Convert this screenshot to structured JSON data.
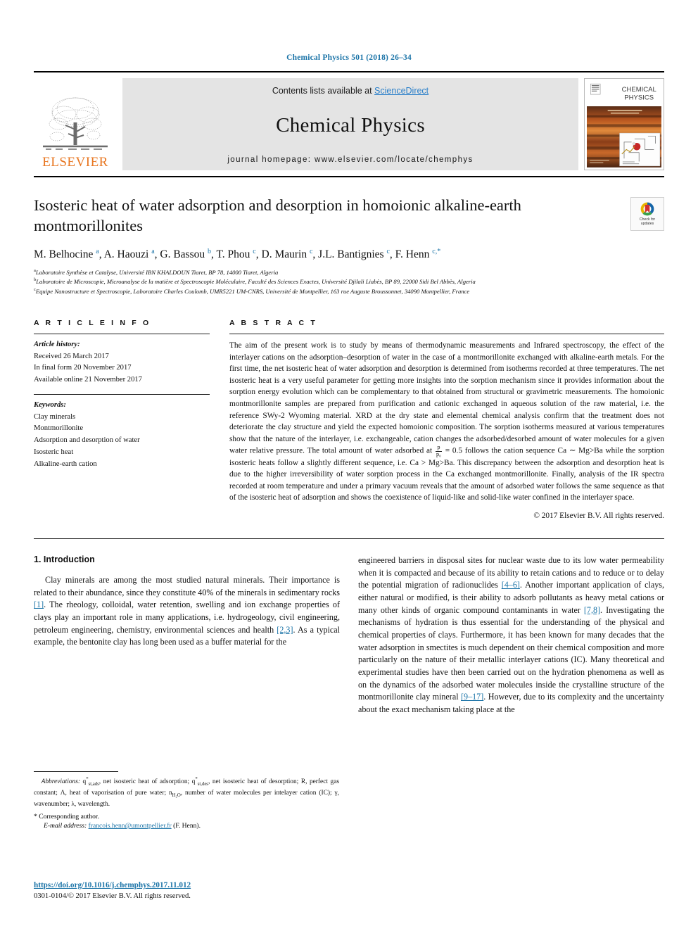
{
  "running_head": "Chemical Physics 501 (2018) 26–34",
  "banner": {
    "publisher": "ELSEVIER",
    "contents_prefix": "Contents lists available at ",
    "contents_link": "ScienceDirect",
    "journal_title": "Chemical Physics",
    "homepage": "journal homepage: www.elsevier.com/locate/chemphys",
    "cover_title_line1": "CHEMICAL",
    "cover_title_line2": "PHYSICS"
  },
  "article": {
    "title": "Isosteric heat of water adsorption and desorption in homoionic alkaline-earth montmorillonites",
    "crossmark_line1": "Check for",
    "crossmark_line2": "updates",
    "authors_html": "M. Belhocine <sup>a</sup>, A. Haouzi <sup>a</sup>, G. Bassou <sup>b</sup>, T. Phou <sup>c</sup>, D. Maurin <sup>c</sup>, J.L. Bantignies <sup>c</sup>, F. Henn <sup>c,*</sup>",
    "affiliations": [
      {
        "marker": "a",
        "text": "Laboratoire Synthèse et Catalyse, Université IBN KHALDOUN Tiaret, BP 78, 14000 Tiaret, Algeria"
      },
      {
        "marker": "b",
        "text": "Laboratoire de Microscopie, Microanalyse de la matière et Spectroscopie Moléculaire, Faculté des Sciences Exactes, Université Djilali Liabès, BP 89, 22000 Sidi Bel Abbès, Algeria"
      },
      {
        "marker": "c",
        "text": "Equipe Nanostructure et Spectroscopie, Laboratoire Charles Coulomb, UMR5221 UM-CNRS, Université de Montpellier, 163 rue Auguste Broussonnet, 34090 Montpellier, France"
      }
    ]
  },
  "article_info": {
    "heading": "A R T I C L E   I N F O",
    "history_label": "Article history:",
    "history": [
      "Received 26 March 2017",
      "In final form 20 November 2017",
      "Available online 21 November 2017"
    ],
    "keywords_label": "Keywords:",
    "keywords": [
      "Clay minerals",
      "Montmorillonite",
      "Adsorption and desorption of water",
      "Isosteric heat",
      "Alkaline-earth cation"
    ]
  },
  "abstract": {
    "heading": "A B S T R A C T",
    "part1": "The aim of the present work is to study by means of thermodynamic measurements and Infrared spectroscopy, the effect of the interlayer cations on the adsorption–desorption of water in the case of a montmorillonite exchanged with alkaline-earth metals. For the first time, the net isosteric heat of water adsorption and desorption is determined from isotherms recorded at three temperatures. The net isosteric heat is a very useful parameter for getting more insights into the sorption mechanism since it provides information about the sorption energy evolution which can be complementary to that obtained from structural or gravimetric measurements. The homoionic montmorillonite samples are prepared from purification and cationic exchanged in aqueous solution of the raw material, i.e. the reference SWy-2 Wyoming material. XRD at the dry state and elemental chemical analysis confirm that the treatment does not deteriorate the clay structure and yield the expected homoionic composition. The sorption isotherms measured at various temperatures show that the nature of the interlayer, i.e. exchangeable, cation changes the adsorbed/desorbed amount of water molecules for a given water relative pressure. The total amount of water adsorbed at ",
    "frac_num": "p",
    "frac_den": "p₀",
    "part2": " = 0.5 follows the cation sequence Ca ∼ Mg>Ba while the sorption isosteric heats follow a slightly different sequence, i.e. Ca > Mg>Ba. This discrepancy between the adsorption and desorption heat is due to the higher irreversibility of water sorption process in the Ca exchanged montmorillonite. Finally, analysis of the IR spectra recorded at room temperature and under a primary vacuum reveals that the amount of adsorbed water follows the same sequence as that of the isosteric heat of adsorption and shows the coexistence of liquid-like and solid-like water confined in the interlayer space.",
    "copyright": "© 2017 Elsevier B.V. All rights reserved."
  },
  "introduction": {
    "heading": "1. Introduction",
    "left_part1": "Clay minerals are among the most studied natural minerals. Their importance is related to their abundance, since they constitute 40% of the minerals in sedimentary rocks ",
    "ref1": "[1]",
    "left_part2": ". The rheology, colloidal, water retention, swelling and ion exchange properties of clays play an important role in many applications, i.e. hydrogeology, civil engineering, petroleum engineering, chemistry, environmental sciences and health ",
    "ref2": "[2,3]",
    "left_part3": ". As a typical example, the bentonite clay has long been used as a buffer material for the",
    "right_part1": "engineered barriers in disposal sites for nuclear waste due to its low water permeability when it is compacted and because of its ability to retain cations and to reduce or to delay the potential migration of radionuclides ",
    "ref3": "[4–6]",
    "right_part2": ". Another important application of clays, either natural or modified, is their ability to adsorb pollutants as heavy metal cations or many other kinds of organic compound contaminants in water ",
    "ref4": "[7,8]",
    "right_part3": ". Investigating the mechanisms of hydration is thus essential for the understanding of the physical and chemical properties of clays. Furthermore, it has been known for many decades that the water adsorption in smectites is much dependent on their chemical composition and more particularly on the nature of their metallic interlayer cations (IC). Many theoretical and experimental studies have then been carried out on the hydration phenomena as well as on the dynamics of the adsorbed water molecules inside the crystalline structure of the montmorillonite clay mineral ",
    "ref5": "[9–17]",
    "right_part4": ". However, due to its complexity and the uncertainty about the exact mechanism taking place at the"
  },
  "footnote": {
    "abbrev_label": "Abbreviations:",
    "abbrev_text_a": " q",
    "abbrev_text_b": ", net isosteric heat of adsorption; q",
    "abbrev_text_c": ", net isosteric heat of desorption; R, perfect gas constant; Λ, heat of vaporisation of pure water; n",
    "abbrev_text_d": ", number of water molecules per intelayer cation (IC); γ, wavenumber; λ, wavelength.",
    "corresponding": "* Corresponding author.",
    "email_label": "E-mail address:",
    "email": "francois.henn@umontpellier.fr",
    "email_suffix": " (F. Henn)."
  },
  "footer": {
    "doi": "https://doi.org/10.1016/j.chemphys.2017.11.012",
    "issn": "0301-0104/© 2017 Elsevier B.V. All rights reserved."
  },
  "colors": {
    "link_blue": "#1a73a7",
    "elsevier_orange": "#E87722",
    "banner_grey": "#e4e4e4"
  }
}
